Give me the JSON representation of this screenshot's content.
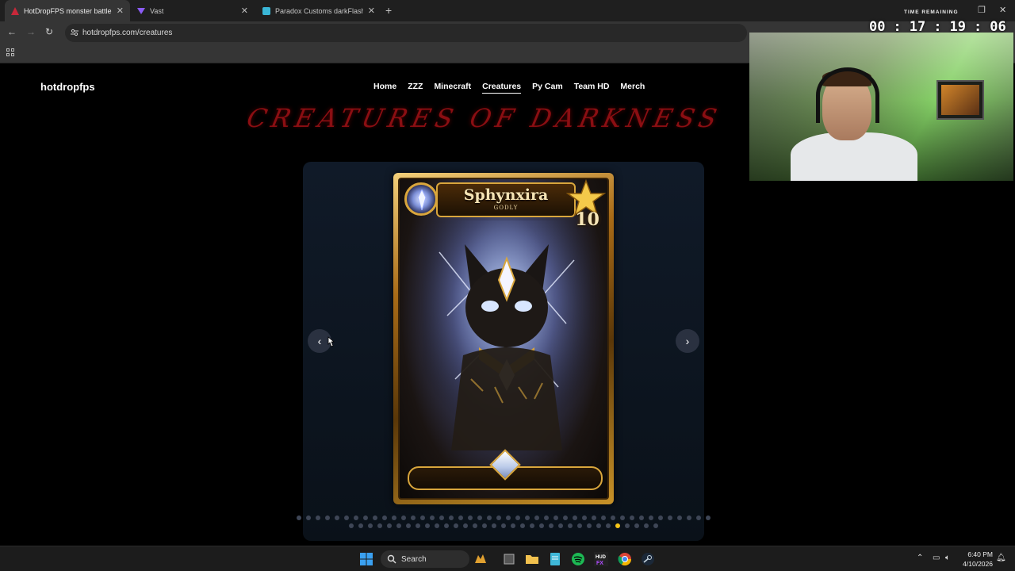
{
  "browser": {
    "tabs": [
      {
        "title": "HotDropFPS monster battle styl",
        "active": true
      },
      {
        "title": "Vast",
        "active": false
      },
      {
        "title": "Paradox Customs darkFlash DP",
        "active": false
      }
    ],
    "new_tab": "+",
    "url": "hotdropfps.com/creatures"
  },
  "site": {
    "brand": "hotdropfps",
    "nav": [
      "Home",
      "ZZZ",
      "Minecraft",
      "Creatures",
      "Py Cam",
      "Team HD",
      "Merch"
    ],
    "current_nav": "Creatures",
    "hero_text": "CREATURES OF DARKNESS"
  },
  "carousel": {
    "prev": "‹",
    "next": "›",
    "card": {
      "name": "Sphynxira",
      "rarity": "GODLY",
      "level": "10"
    },
    "dots_row1": 44,
    "dots_row2": 33,
    "active_dot_row": 2,
    "active_dot_index": 28
  },
  "overlay": {
    "timer_label": "TIME REMAINING",
    "hours": "00",
    "minutes": "17",
    "seconds": "19",
    "centis": "06"
  },
  "taskbar": {
    "search": "Search",
    "time": "6:40 PM",
    "date": "4/10/2026"
  },
  "colors": {
    "accent_dot": "#f5c518",
    "hero_red": "#8a0e12",
    "card_gold": "#d9a63c"
  }
}
